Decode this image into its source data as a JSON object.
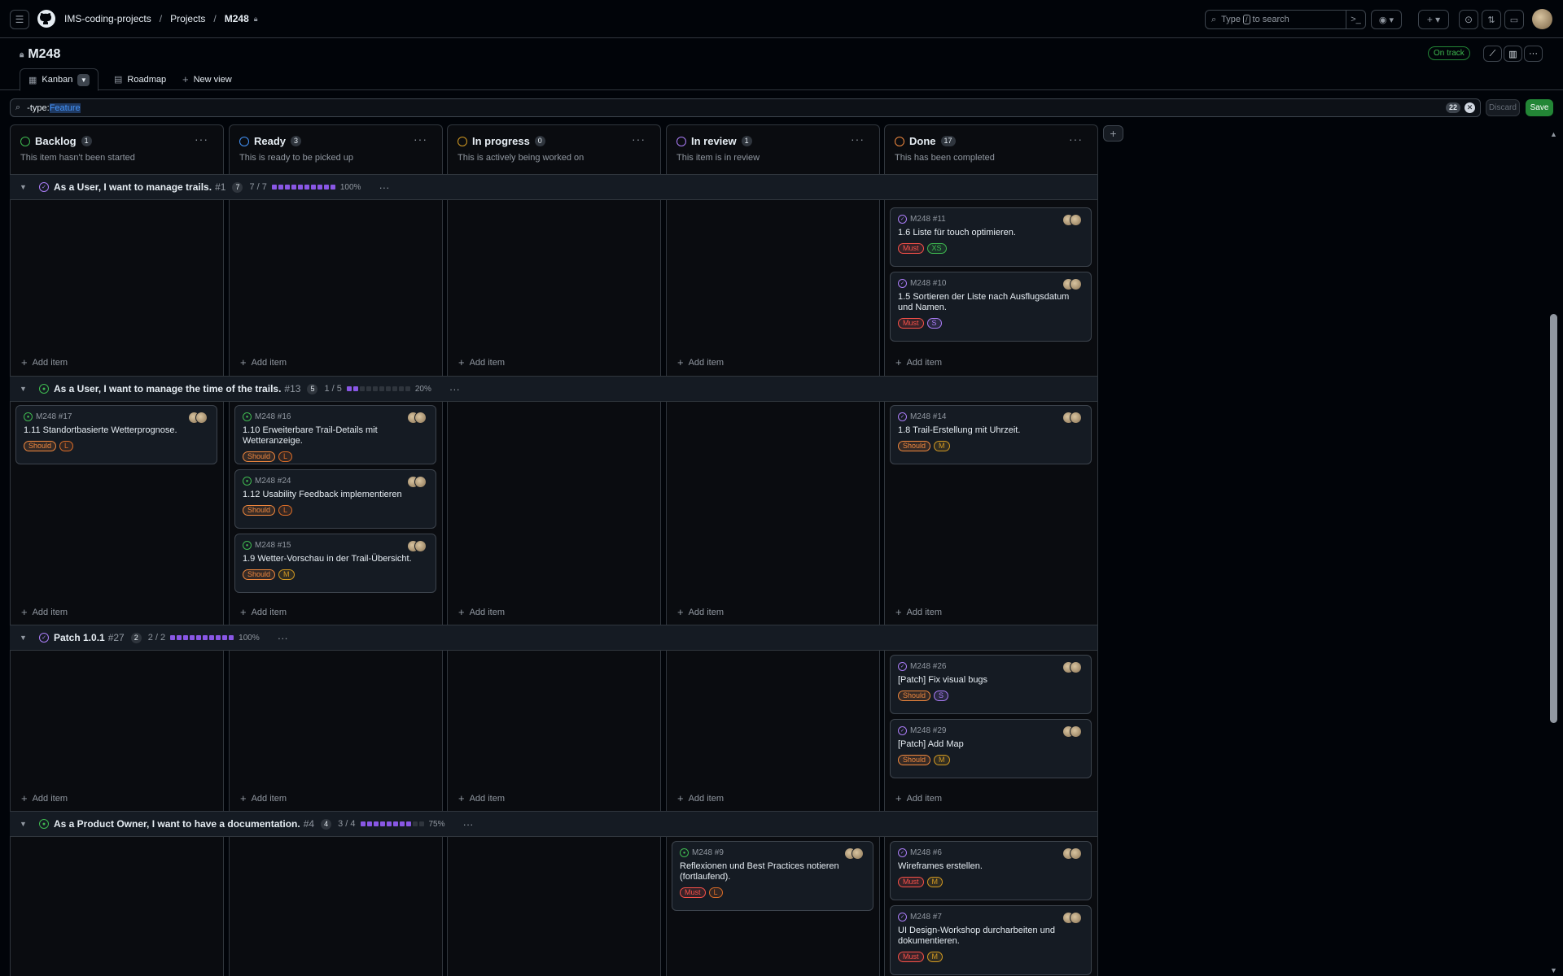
{
  "header": {
    "breadcrumbs": [
      "IMS-coding-projects",
      "Projects",
      "M248"
    ],
    "search_prefix": "Type",
    "search_key": "/",
    "search_suffix": "to search"
  },
  "project": {
    "title": "M248",
    "status": "On track"
  },
  "tabs": [
    {
      "label": "Kanban"
    },
    {
      "label": "Roadmap"
    },
    {
      "label": "New view"
    }
  ],
  "filter": {
    "prefix": "-type:",
    "value": "Feature",
    "count": "22",
    "discard": "Discard",
    "save": "Save"
  },
  "columns": [
    {
      "name": "Backlog",
      "count": "1",
      "desc": "This item hasn't been started",
      "color": "#3fb950"
    },
    {
      "name": "Ready",
      "count": "3",
      "desc": "This is ready to be picked up",
      "color": "#4493f8"
    },
    {
      "name": "In progress",
      "count": "0",
      "desc": "This is actively being worked on",
      "color": "#d29922"
    },
    {
      "name": "In review",
      "count": "1",
      "desc": "This item is in review",
      "color": "#ab7df8"
    },
    {
      "name": "Done",
      "count": "17",
      "desc": "This has been completed",
      "color": "#f0883e"
    }
  ],
  "add_item": "Add item",
  "groups": [
    {
      "title": "As a User, I want to manage trails.",
      "num": "#1",
      "count": "7",
      "progress": "7 / 7",
      "pct": "100%",
      "fraction": 1.0
    },
    {
      "title": "As a User, I want to manage the time of the trails.",
      "num": "#13",
      "count": "5",
      "progress": "1 / 5",
      "pct": "20%",
      "fraction": 0.2
    },
    {
      "title": "Patch 1.0.1",
      "num": "#27",
      "count": "2",
      "progress": "2 / 2",
      "pct": "100%",
      "fraction": 1.0
    },
    {
      "title": "As a Product Owner, I want to have a documentation.",
      "num": "#4",
      "count": "4",
      "progress": "3 / 4",
      "pct": "75%",
      "fraction": 0.75
    }
  ],
  "cards": {
    "g0_done_1": {
      "ref": "M248 #11",
      "title": "1.6 Liste für touch optimieren.",
      "priority": "Must",
      "size": "XS"
    },
    "g0_done_2": {
      "ref": "M248 #10",
      "title": "1.5 Sortieren der Liste nach Ausflugsdatum und Namen.",
      "priority": "Must",
      "size": "S"
    },
    "g1_backlog_1": {
      "ref": "M248 #17",
      "title": "1.11 Standortbasierte Wetterprognose.",
      "priority": "Should",
      "size": "L"
    },
    "g1_ready_1": {
      "ref": "M248 #16",
      "title": "1.10 Erweiterbare Trail-Details mit Wetteranzeige.",
      "priority": "Should",
      "size": "L"
    },
    "g1_ready_2": {
      "ref": "M248 #24",
      "title": "1.12 Usability Feedback implementieren",
      "priority": "Should",
      "size": "L"
    },
    "g1_ready_3": {
      "ref": "M248 #15",
      "title": "1.9 Wetter-Vorschau in der Trail-Übersicht.",
      "priority": "Should",
      "size": "M"
    },
    "g1_done_1": {
      "ref": "M248 #14",
      "title": "1.8 Trail-Erstellung mit Uhrzeit.",
      "priority": "Should",
      "size": "M"
    },
    "g2_done_1": {
      "ref": "M248 #26",
      "title": "[Patch] Fix visual bugs",
      "priority": "Should",
      "size": "S"
    },
    "g2_done_2": {
      "ref": "M248 #29",
      "title": "[Patch] Add Map",
      "priority": "Should",
      "size": "M"
    },
    "g3_review_1": {
      "ref": "M248 #9",
      "title": "Reflexionen und Best Practices notieren (fortlaufend).",
      "priority": "Must",
      "size": "L"
    },
    "g3_done_1": {
      "ref": "M248 #6",
      "title": "Wireframes erstellen.",
      "priority": "Must",
      "size": "M"
    },
    "g3_done_2": {
      "ref": "M248 #7",
      "title": "UI Design-Workshop durcharbeiten und dokumentieren.",
      "priority": "Must",
      "size": "M"
    }
  },
  "colors": {
    "must": "#f85149",
    "should": "#f0883e",
    "size_l": "#db6d28",
    "size_m": "#d29922",
    "size_s": "#ab7df8",
    "size_xs": "#3fb950",
    "open_issue": "#3fb950",
    "closed_issue": "#ab7df8"
  }
}
